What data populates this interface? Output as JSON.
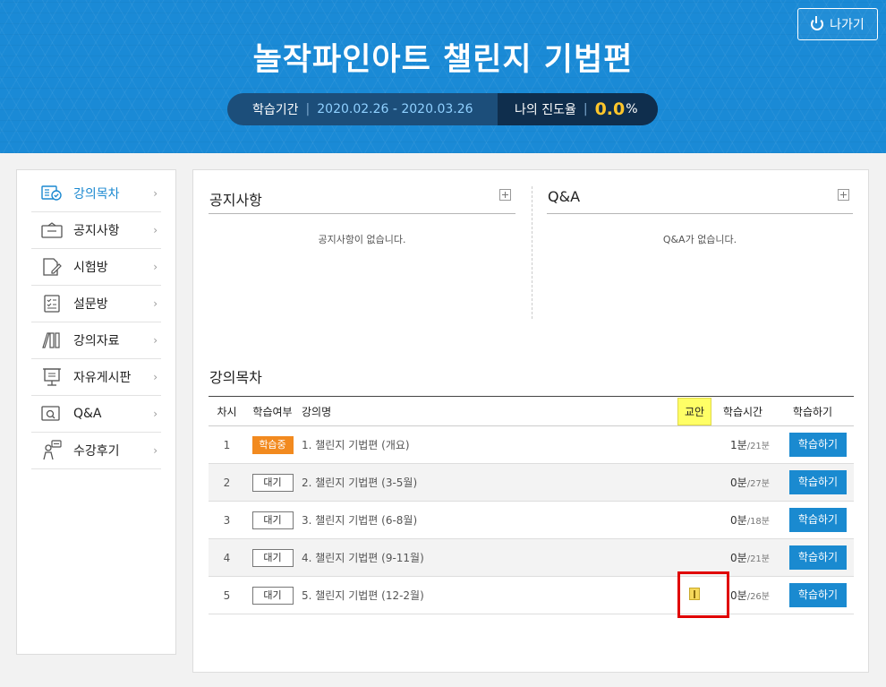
{
  "header": {
    "exit_label": "나가기",
    "title": "놀작파인아트 챌린지 기법편",
    "period_label": "학습기간",
    "period_dates": "2020.02.26 - 2020.03.26",
    "progress_label": "나의 진도율",
    "progress_value": "0.0",
    "progress_unit": "%"
  },
  "sidebar": {
    "items": [
      {
        "label": "강의목차",
        "icon": "lecture-list-icon",
        "active": true
      },
      {
        "label": "공지사항",
        "icon": "notice-icon"
      },
      {
        "label": "시험방",
        "icon": "exam-icon"
      },
      {
        "label": "설문방",
        "icon": "survey-icon"
      },
      {
        "label": "강의자료",
        "icon": "materials-icon"
      },
      {
        "label": "자유게시판",
        "icon": "board-icon"
      },
      {
        "label": "Q&A",
        "icon": "qa-icon"
      },
      {
        "label": "수강후기",
        "icon": "review-icon"
      }
    ]
  },
  "notice": {
    "title": "공지사항",
    "empty": "공지사항이 없습니다."
  },
  "qa": {
    "title": "Q&A",
    "empty": "Q&A가 없습니다."
  },
  "lectures": {
    "title": "강의목차",
    "headers": {
      "no": "차시",
      "status": "학습여부",
      "name": "강의명",
      "plan": "교안",
      "time": "학습시간",
      "action": "학습하기"
    },
    "rows": [
      {
        "no": "1",
        "status": "학습중",
        "name": "1. 챌린지 기법편 (개요)",
        "time_done": "1분",
        "time_total": "/21분",
        "action": "학습하기"
      },
      {
        "no": "2",
        "status": "대기",
        "name": "2. 챌린지 기법편 (3-5월)",
        "time_done": "0분",
        "time_total": "/27분",
        "action": "학습하기"
      },
      {
        "no": "3",
        "status": "대기",
        "name": "3. 챌린지 기법편 (6-8월)",
        "time_done": "0분",
        "time_total": "/18분",
        "action": "학습하기"
      },
      {
        "no": "4",
        "status": "대기",
        "name": "4. 챌린지 기법편 (9-11월)",
        "time_done": "0분",
        "time_total": "/21분",
        "action": "학습하기"
      },
      {
        "no": "5",
        "status": "대기",
        "name": "5. 챌린지 기법편 (12-2월)",
        "time_done": "0분",
        "time_total": "/26분",
        "action": "학습하기"
      }
    ]
  },
  "colors": {
    "header_blue": "#1a8ad6",
    "accent_orange": "#f28a1f",
    "progress_yellow": "#ffc62b",
    "button_blue": "#1a8ad0"
  }
}
